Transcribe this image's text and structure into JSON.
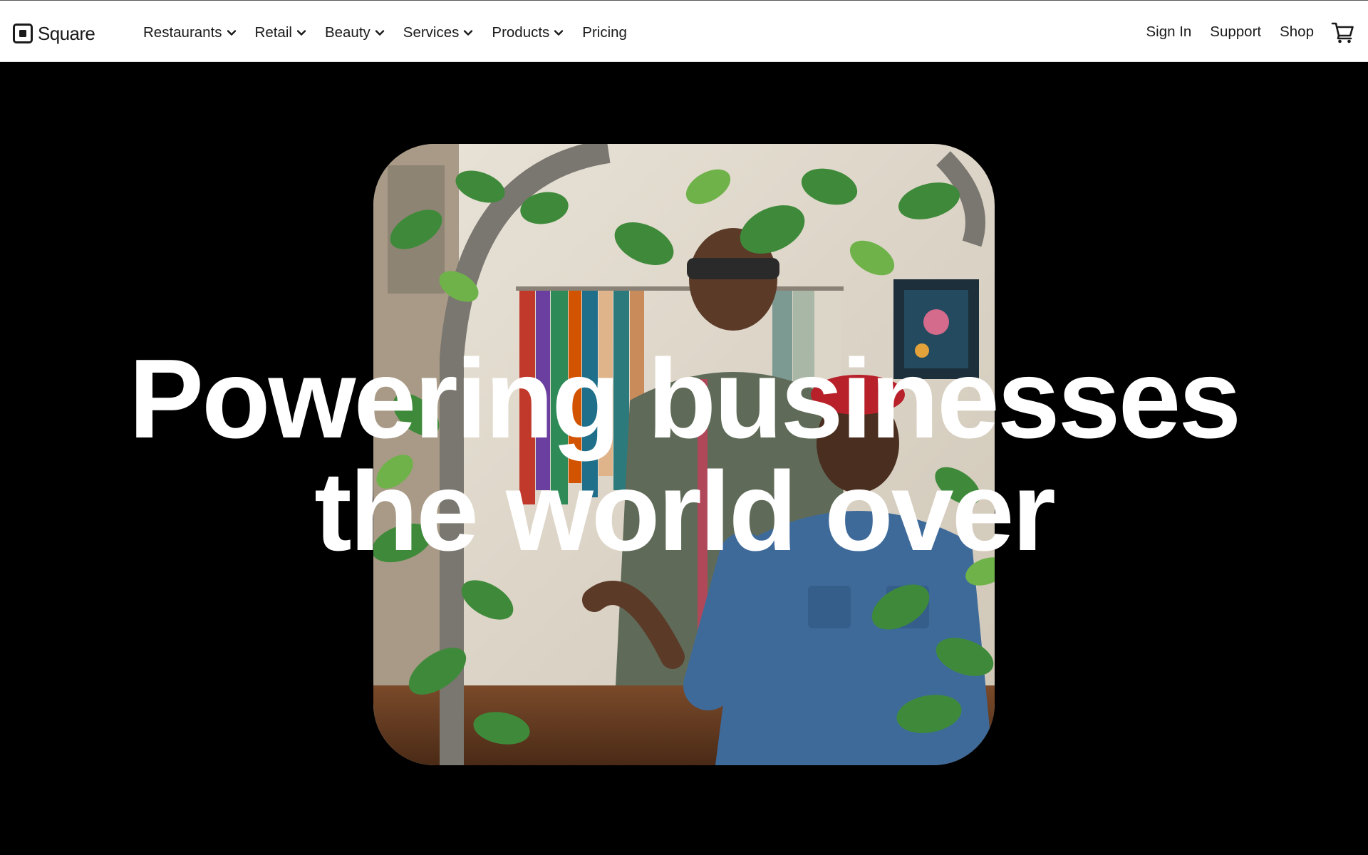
{
  "brand": {
    "name": "Square",
    "logo_icon": "square-logo-icon"
  },
  "nav": {
    "menu": [
      {
        "label": "Restaurants",
        "has_dropdown": true
      },
      {
        "label": "Retail",
        "has_dropdown": true
      },
      {
        "label": "Beauty",
        "has_dropdown": true
      },
      {
        "label": "Services",
        "has_dropdown": true
      },
      {
        "label": "Products",
        "has_dropdown": true
      },
      {
        "label": "Pricing",
        "has_dropdown": false
      }
    ],
    "right": {
      "sign_in": "Sign In",
      "support": "Support",
      "shop": "Shop",
      "cart_icon": "shopping-cart-icon"
    }
  },
  "hero": {
    "headline_line1": "Powering businesses",
    "headline_line2": "the world over",
    "background_color": "#000000",
    "text_color": "#ffffff"
  }
}
